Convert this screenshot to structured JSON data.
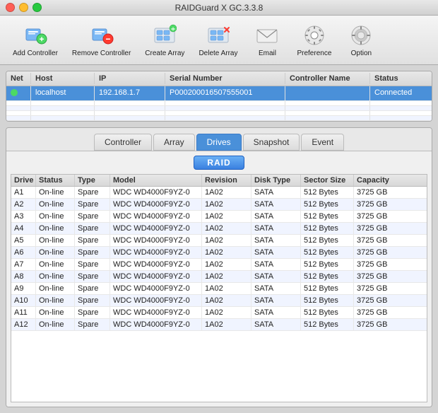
{
  "titleBar": {
    "title": "RAIDGuard X GC.3.3.8"
  },
  "toolbar": {
    "items": [
      {
        "id": "add-controller",
        "label": "Add Controller",
        "icon": "add-ctrl"
      },
      {
        "id": "remove-controller",
        "label": "Remove Controller",
        "icon": "remove-ctrl"
      },
      {
        "id": "create-array",
        "label": "Create Array",
        "icon": "create-arr"
      },
      {
        "id": "delete-array",
        "label": "Delete Array",
        "icon": "delete-arr"
      },
      {
        "id": "email",
        "label": "Email",
        "icon": "email"
      },
      {
        "id": "preference",
        "label": "Preference",
        "icon": "preference"
      },
      {
        "id": "option",
        "label": "Option",
        "icon": "option"
      }
    ]
  },
  "topTable": {
    "headers": [
      "Net",
      "Host",
      "IP",
      "Serial Number",
      "Controller Name",
      "Status"
    ],
    "rows": [
      {
        "net": "green",
        "host": "localhost",
        "ip": "192.168.1.7",
        "serial": "P000200016507555001",
        "controllerName": "",
        "status": "Connected",
        "selected": true
      }
    ],
    "emptyRows": 4
  },
  "tabs": [
    {
      "id": "controller",
      "label": "Controller",
      "active": false
    },
    {
      "id": "array",
      "label": "Array",
      "active": false
    },
    {
      "id": "drives",
      "label": "Drives",
      "active": true
    },
    {
      "id": "snapshot",
      "label": "Snapshot",
      "active": false
    },
    {
      "id": "event",
      "label": "Event",
      "active": false
    }
  ],
  "raidLabel": "RAID",
  "drivesTable": {
    "headers": [
      "Drive",
      "Status",
      "Type",
      "Model",
      "Revision",
      "Disk Type",
      "Sector Size",
      "Capacity"
    ],
    "rows": [
      {
        "drive": "A1",
        "status": "On-line",
        "type": "Spare",
        "model": "WDC WD4000F9YZ-0",
        "revision": "1A02",
        "diskType": "SATA",
        "sectorSize": "512 Bytes",
        "capacity": "3725 GB"
      },
      {
        "drive": "A2",
        "status": "On-line",
        "type": "Spare",
        "model": "WDC WD4000F9YZ-0",
        "revision": "1A02",
        "diskType": "SATA",
        "sectorSize": "512 Bytes",
        "capacity": "3725 GB"
      },
      {
        "drive": "A3",
        "status": "On-line",
        "type": "Spare",
        "model": "WDC WD4000F9YZ-0",
        "revision": "1A02",
        "diskType": "SATA",
        "sectorSize": "512 Bytes",
        "capacity": "3725 GB"
      },
      {
        "drive": "A4",
        "status": "On-line",
        "type": "Spare",
        "model": "WDC WD4000F9YZ-0",
        "revision": "1A02",
        "diskType": "SATA",
        "sectorSize": "512 Bytes",
        "capacity": "3725 GB"
      },
      {
        "drive": "A5",
        "status": "On-line",
        "type": "Spare",
        "model": "WDC WD4000F9YZ-0",
        "revision": "1A02",
        "diskType": "SATA",
        "sectorSize": "512 Bytes",
        "capacity": "3725 GB"
      },
      {
        "drive": "A6",
        "status": "On-line",
        "type": "Spare",
        "model": "WDC WD4000F9YZ-0",
        "revision": "1A02",
        "diskType": "SATA",
        "sectorSize": "512 Bytes",
        "capacity": "3725 GB"
      },
      {
        "drive": "A7",
        "status": "On-line",
        "type": "Spare",
        "model": "WDC WD4000F9YZ-0",
        "revision": "1A02",
        "diskType": "SATA",
        "sectorSize": "512 Bytes",
        "capacity": "3725 GB"
      },
      {
        "drive": "A8",
        "status": "On-line",
        "type": "Spare",
        "model": "WDC WD4000F9YZ-0",
        "revision": "1A02",
        "diskType": "SATA",
        "sectorSize": "512 Bytes",
        "capacity": "3725 GB"
      },
      {
        "drive": "A9",
        "status": "On-line",
        "type": "Spare",
        "model": "WDC WD4000F9YZ-0",
        "revision": "1A02",
        "diskType": "SATA",
        "sectorSize": "512 Bytes",
        "capacity": "3725 GB"
      },
      {
        "drive": "A10",
        "status": "On-line",
        "type": "Spare",
        "model": "WDC WD4000F9YZ-0",
        "revision": "1A02",
        "diskType": "SATA",
        "sectorSize": "512 Bytes",
        "capacity": "3725 GB"
      },
      {
        "drive": "A11",
        "status": "On-line",
        "type": "Spare",
        "model": "WDC WD4000F9YZ-0",
        "revision": "1A02",
        "diskType": "SATA",
        "sectorSize": "512 Bytes",
        "capacity": "3725 GB"
      },
      {
        "drive": "A12",
        "status": "On-line",
        "type": "Spare",
        "model": "WDC WD4000F9YZ-0",
        "revision": "1A02",
        "diskType": "SATA",
        "sectorSize": "512 Bytes",
        "capacity": "3725 GB"
      }
    ]
  },
  "colors": {
    "accent": "#4a90d9",
    "selected": "#4a90d9",
    "netGreen": "#4cd964"
  }
}
